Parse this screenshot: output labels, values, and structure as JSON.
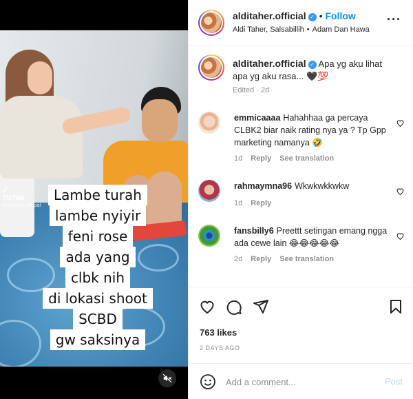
{
  "post": {
    "username": "alditaher.official",
    "verified": true,
    "follow_label": "Follow",
    "tagged": "Aldi Taher, Salsabillih",
    "music": "Adam Dan Hawa",
    "more_icon": "more-horizontal-icon"
  },
  "video": {
    "watermark_brand": "TikTok",
    "watermark_handle": "@alditaher.official",
    "overlay_lines": [
      "Lambe turah",
      "lambe nyiyir",
      "feni rose",
      "ada yang",
      "clbk nih",
      "di lokasi shoot",
      "SCBD",
      "gw saksinya"
    ],
    "mute_icon": "volume-off-icon"
  },
  "caption": {
    "username": "alditaher.official",
    "text": "Apa yg aku lihat apa yg aku rasa... 🖤💯",
    "edited": "Edited",
    "age": "2d"
  },
  "comments": [
    {
      "username": "emmicaaaa",
      "text": "Hahahhaa ga percaya CLBK2 biar naik rating nya ya ? Tp Gpp marketing namanya 🤣",
      "age": "1d",
      "reply": "Reply",
      "translate": "See translation"
    },
    {
      "username": "rahmaymna96",
      "text": "Wkwkwkkwkw",
      "age": "1d",
      "reply": "Reply",
      "translate": ""
    },
    {
      "username": "fansbilly6",
      "text": "Preettt setingan emang ngga ada cewe lain 😂😂😂😂😂",
      "age": "2d",
      "reply": "Reply",
      "translate": "See translation"
    }
  ],
  "actions": {
    "like_icon": "heart-icon",
    "comment_icon": "comment-icon",
    "share_icon": "send-icon",
    "save_icon": "bookmark-icon",
    "likes": "763 likes",
    "date": "2 DAYS AGO"
  },
  "add_comment": {
    "placeholder": "Add a comment...",
    "post_label": "Post",
    "emoji_icon": "emoji-icon"
  },
  "colors": {
    "link": "#0095f6",
    "verified": "#3897f0",
    "muted": "#8e8e8e",
    "post_disabled": "#b2dffc"
  }
}
